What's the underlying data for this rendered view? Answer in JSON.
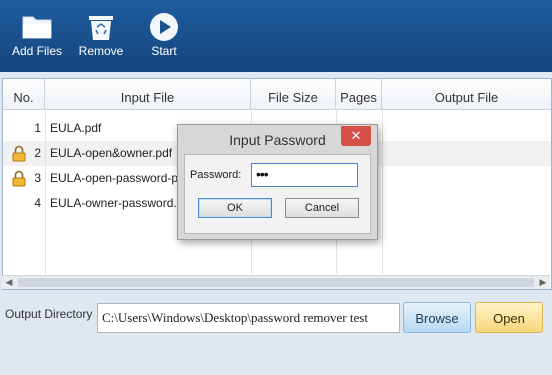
{
  "toolbar": {
    "add_files": "Add Files",
    "remove": "Remove",
    "start": "Start"
  },
  "table": {
    "headers": {
      "no": "No.",
      "input": "Input File",
      "size": "File Size",
      "pages": "Pages",
      "output": "Output File"
    },
    "rows": [
      {
        "no": "1",
        "file": "EULA.pdf",
        "locked": false
      },
      {
        "no": "2",
        "file": "EULA-open&owner.pdf",
        "locked": true
      },
      {
        "no": "3",
        "file": "EULA-open-password-protected.pdf",
        "locked": true
      },
      {
        "no": "4",
        "file": "EULA-owner-password.pdf",
        "locked": false
      }
    ]
  },
  "output": {
    "label": "Output Directory",
    "path": "C:\\Users\\Windows\\Desktop\\password remover test",
    "browse": "Browse",
    "open": "Open"
  },
  "dialog": {
    "title": "Input Password",
    "close": "✕",
    "password_label": "Password:",
    "password_value": "•••",
    "ok": "OK",
    "cancel": "Cancel"
  },
  "colors": {
    "toolbar": "#1a5190",
    "close": "#d6504a",
    "browse": "#b7d8f1",
    "open": "#f7d77a"
  }
}
